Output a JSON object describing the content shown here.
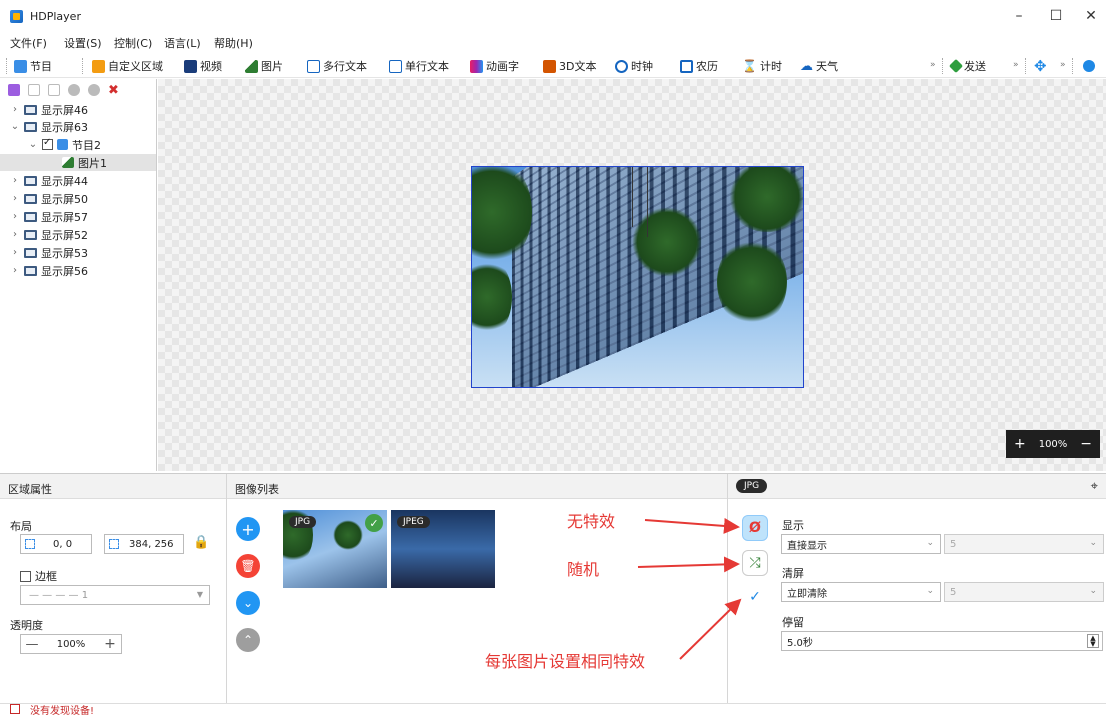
{
  "window": {
    "title": "HDPlayer",
    "minimize": "–",
    "maximize": "☐",
    "close": "✕"
  },
  "menu": [
    "文件(F)",
    "设置(S)",
    "控制(C)",
    "语言(L)",
    "帮助(H)"
  ],
  "toolbar": {
    "program": "节目",
    "custom_area": "自定义区域",
    "video": "视频",
    "picture": "图片",
    "multi_text": "多行文本",
    "single_text": "单行文本",
    "anim_text": "动画字",
    "text_3d": "3D文本",
    "clock": "时钟",
    "lunar": "农历",
    "timer": "计时",
    "weather": "天气",
    "send": "发送",
    "more": "»"
  },
  "tree": {
    "screens_top": [
      "显示屏46"
    ],
    "expanded_screen": "显示屏63",
    "program": "节目2",
    "picture_item": "图片1",
    "screens_bottom": [
      "显示屏44",
      "显示屏50",
      "显示屏57",
      "显示屏52",
      "显示屏53",
      "显示屏56"
    ]
  },
  "canvas": {
    "zoom_plus": "+",
    "zoom_level": "100%",
    "zoom_minus": "−"
  },
  "area_props": {
    "header": "区域属性",
    "layout_label": "布局",
    "position": "0, 0",
    "size": "384, 256",
    "border_label": "边框",
    "border_value": "1",
    "opacity_label": "透明度",
    "opacity_value": "100%",
    "minus": "—",
    "plus": "+"
  },
  "image_list": {
    "header": "图像列表",
    "thumbs": [
      {
        "badge": "JPG",
        "selected": true
      },
      {
        "badge": "JPEG",
        "selected": false
      }
    ]
  },
  "jpg_panel": {
    "header_badge": "JPG",
    "display_label": "显示",
    "display_value": "直接显示",
    "display_speed": "5",
    "clear_label": "清屏",
    "clear_value": "立即清除",
    "clear_speed": "5",
    "stay_label": "停留",
    "stay_value": "5.0秒"
  },
  "annotations": {
    "no_effect": "无特效",
    "random": "随机",
    "same_effect": "每张图片设置相同特效"
  },
  "status": {
    "text": "没有发现设备!"
  },
  "colors": {
    "accent": "#2196f3",
    "annotation": "#e53935",
    "selection_border": "#2244cc"
  }
}
